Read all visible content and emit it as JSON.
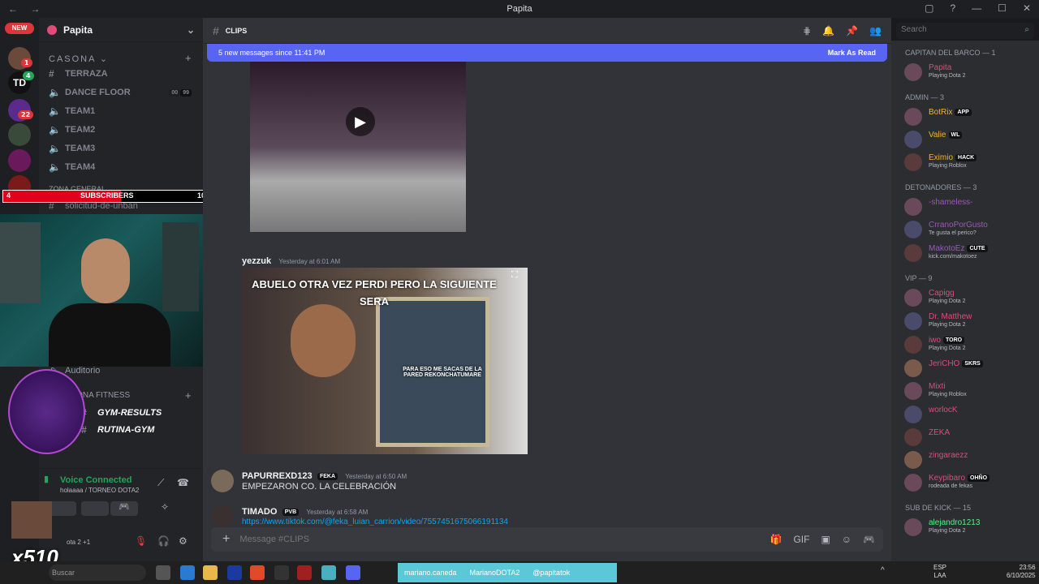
{
  "window": {
    "title": "Papita"
  },
  "server": {
    "name": "Papita",
    "new_badge": "NEW"
  },
  "rail_badges": [
    "1",
    "4",
    "22",
    "10"
  ],
  "rail_text": "TD",
  "categories": {
    "casona": "CASONA",
    "zona_general": "ZONA GENERAL",
    "zona_fitness": "ZONA FITNESS"
  },
  "channels": [
    {
      "label": "TERRAZA",
      "icon": "#"
    },
    {
      "label": "DANCE FLOOR",
      "icon": "speaker",
      "counts": [
        "00",
        "99"
      ]
    },
    {
      "label": "TEAM1",
      "icon": "speaker"
    },
    {
      "label": "TEAM2",
      "icon": "speaker"
    },
    {
      "label": "TEAM3",
      "icon": "speaker"
    },
    {
      "label": "TEAM4",
      "icon": "speaker"
    },
    {
      "label": "solicitud-de-unban",
      "icon": "#"
    },
    {
      "label": "Auditorio",
      "icon": "speaker"
    },
    {
      "label": "GYM-RESULTS",
      "icon": "#"
    },
    {
      "label": "RUTINA-GYM",
      "icon": "#"
    }
  ],
  "subs_overlay": {
    "left": "4",
    "label": "SUBSCRIBERS",
    "right": "10"
  },
  "voice": {
    "status": "Voice Connected",
    "detail": "holaaaa / TORNEO DOTA2"
  },
  "user_panel": {
    "status": "ota 2 +1",
    "multiplier": "x510"
  },
  "channel_header": {
    "name": "CLIPS"
  },
  "banner": {
    "text": "5 new messages since 11:41 PM",
    "action": "Mark As Read"
  },
  "messages": [
    {
      "author": "yezzuk",
      "time": "Yesterday at 6:01 AM",
      "caption": "ABUELO OTRA VEZ PERDI PERO LA SIGUIENTE SERA",
      "sub": "PARA ESO ME SACAS DE LA PARED REKONCHATUMARE"
    },
    {
      "author": "PAPURREXD123",
      "tag": "FEKA",
      "time": "Yesterday at 6:50 AM",
      "text": "EMPEZARON CO. LA CELEBRACIÓN"
    },
    {
      "author": "TIMADO",
      "tag": "PVB",
      "time": "Yesterday at 6:58 AM",
      "text": "https://www.tiktok.com/@feka_luian_carrion/video/7557451675066191134"
    }
  ],
  "composer": {
    "placeholder": "Message #CLIPS"
  },
  "search": {
    "placeholder": "Search"
  },
  "member_groups": [
    {
      "title": "CAPITAN DEL BARCO — 1",
      "members": [
        {
          "name": "Papita",
          "activity": "Playing Dota 2",
          "color": "#e04b7a"
        }
      ]
    },
    {
      "title": "ADMIN — 3",
      "members": [
        {
          "name": "BotRix",
          "tag": "APP",
          "color": "#f0b232"
        },
        {
          "name": "Valie",
          "tag": "WL",
          "color": "#f0b232"
        },
        {
          "name": "Eximio",
          "tag": "HACK",
          "activity": "Playing Roblox",
          "color": "#f0b232"
        }
      ]
    },
    {
      "title": "DETONADORES — 3",
      "members": [
        {
          "name": "-shameless-",
          "color": "#9b59b6"
        },
        {
          "name": "CrranoPorGusto",
          "activity": "Te gusta el perico?",
          "color": "#9b59b6"
        },
        {
          "name": "MakotoEz",
          "tag": "CUTE",
          "activity": "kick.com/makotoez",
          "color": "#9b59b6"
        }
      ]
    },
    {
      "title": "VIP — 9",
      "members": [
        {
          "name": "Capigg",
          "activity": "Playing Dota 2",
          "color": "#e04b7a"
        },
        {
          "name": "Dr. Matthew",
          "activity": "Playing Dota 2",
          "color": "#e04b7a"
        },
        {
          "name": "iwo",
          "tag": "TORO",
          "activity": "Playing Dota 2",
          "color": "#e04b7a"
        },
        {
          "name": "JeriCHO",
          "tag": "SKRS",
          "color": "#e04b7a"
        },
        {
          "name": "Mixti",
          "activity": "Playing Roblox",
          "color": "#e04b7a"
        },
        {
          "name": "worlocK",
          "color": "#e04b7a"
        },
        {
          "name": "ZEKA",
          "color": "#e04b7a"
        },
        {
          "name": "zingaraezz",
          "color": "#e04b7a"
        },
        {
          "name": "Keypibaro",
          "tag": "OHÑO",
          "activity": "rodeada de fekas",
          "color": "#e04b7a"
        }
      ]
    },
    {
      "title": "SUB DE KICK — 15",
      "members": [
        {
          "name": "alejandro1213",
          "activity": "Playing Dota 2",
          "color": "#57f287"
        }
      ]
    }
  ],
  "taskbar": {
    "search": "Buscar",
    "socials": [
      "mariano.caneda",
      "MarianoDOTA2",
      "@papitatok"
    ],
    "lang": "ESP",
    "layout": "LAA",
    "time": "23:56",
    "date": "6/10/2025"
  }
}
